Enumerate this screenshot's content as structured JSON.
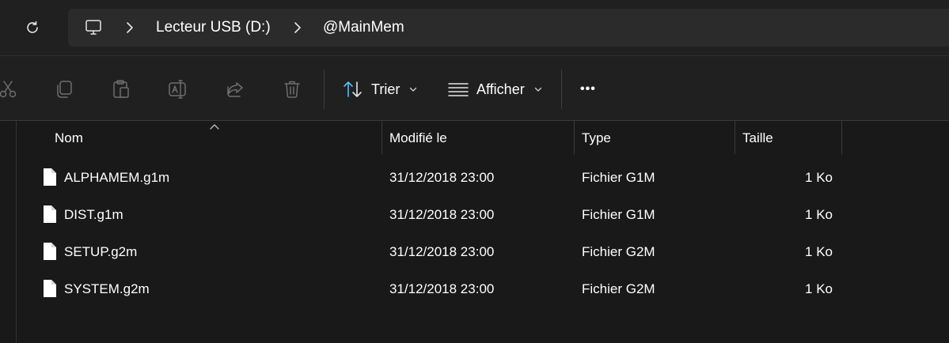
{
  "address_bar": {
    "breadcrumbs": [
      "Lecteur USB (D:)",
      "@MainMem"
    ]
  },
  "command_bar": {
    "icons": [
      "cut-icon",
      "copy-icon",
      "paste-icon",
      "rename-icon",
      "share-icon",
      "delete-icon"
    ],
    "sort_label": "Trier",
    "view_label": "Afficher",
    "more_label": "•••"
  },
  "columns": {
    "name": "Nom",
    "modified": "Modifié le",
    "type": "Type",
    "size": "Taille",
    "sorted_by": "name"
  },
  "files": [
    {
      "name": "ALPHAMEM.g1m",
      "modified": "31/12/2018 23:00",
      "type": "Fichier G1M",
      "size": "1 Ko"
    },
    {
      "name": "DIST.g1m",
      "modified": "31/12/2018 23:00",
      "type": "Fichier G1M",
      "size": "1 Ko"
    },
    {
      "name": "SETUP.g2m",
      "modified": "31/12/2018 23:00",
      "type": "Fichier G2M",
      "size": "1 Ko"
    },
    {
      "name": "SYSTEM.g2m",
      "modified": "31/12/2018 23:00",
      "type": "Fichier G2M",
      "size": "1 Ko"
    }
  ],
  "colors": {
    "background": "#191919",
    "toolbar": "#202020",
    "address_box": "#2b2b2b",
    "accent": "#4cc2ff"
  }
}
